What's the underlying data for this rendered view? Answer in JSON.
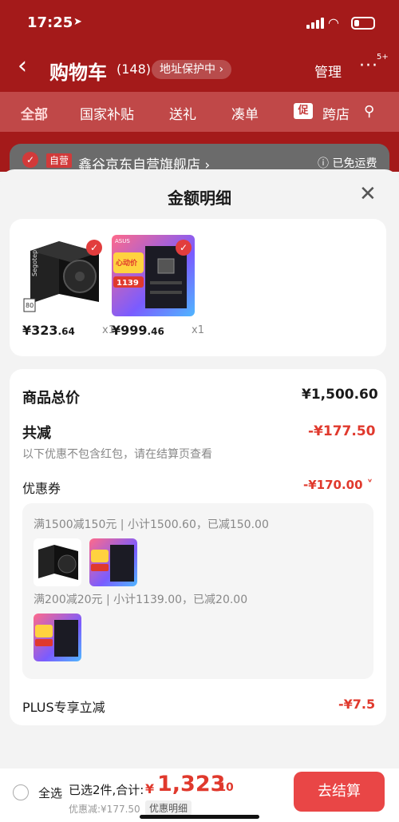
{
  "status": {
    "time": "17:25"
  },
  "nav": {
    "back": "‹",
    "title": "购物车",
    "count": "(148)",
    "addr_protect": "地址保护中 ›",
    "manage": "管理",
    "more": "···",
    "more_badge": "5+"
  },
  "tabs": [
    "全部",
    "国家补贴",
    "送礼",
    "凑单",
    "跨店"
  ],
  "tabs_cut_tag": "促",
  "store": {
    "tag": "自营",
    "name": "鑫谷京东自营旗舰店 ›",
    "shipping": "ⓘ 已免运费"
  },
  "sheet": {
    "title": "金额明细",
    "close": "✕"
  },
  "products": [
    {
      "price_int": "¥323",
      "price_dec": ".64",
      "qty": "x1",
      "img_label": "Segotep",
      "img_badge": "80"
    },
    {
      "price_int": "¥999",
      "price_dec": ".46",
      "qty": "x1",
      "img_label": "ASUS",
      "img_tag": "心动价",
      "img_price": "1139"
    }
  ],
  "summary": {
    "goods_total_label": "商品总价",
    "goods_total_value": "¥1,500.60",
    "total_reduce_label": "共减",
    "total_reduce_value": "-¥177.50",
    "note": "以下优惠不包含红包，请在结算页查看",
    "coupon_label": "优惠券",
    "coupon_value": "-¥170.00 ˅",
    "coupon_rules": [
      "满1500减150元 | 小计1500.60，已减150.00",
      "满200减20元 | 小计1139.00，已减20.00"
    ],
    "plus_label": "PLUS专享立减",
    "plus_value": "-¥7.5"
  },
  "bottom": {
    "select_all": "全选",
    "selected": "已选2件,合计:",
    "currency": "¥",
    "total_int": "1,323",
    "total_dec": ".10",
    "saved": "优惠减:¥177.50",
    "detail": "优惠明细",
    "checkout": "去结算"
  },
  "colors": {
    "accent": "#e0392d",
    "header_bg": "#a41a1a",
    "checkout_bg": "#e94646"
  }
}
